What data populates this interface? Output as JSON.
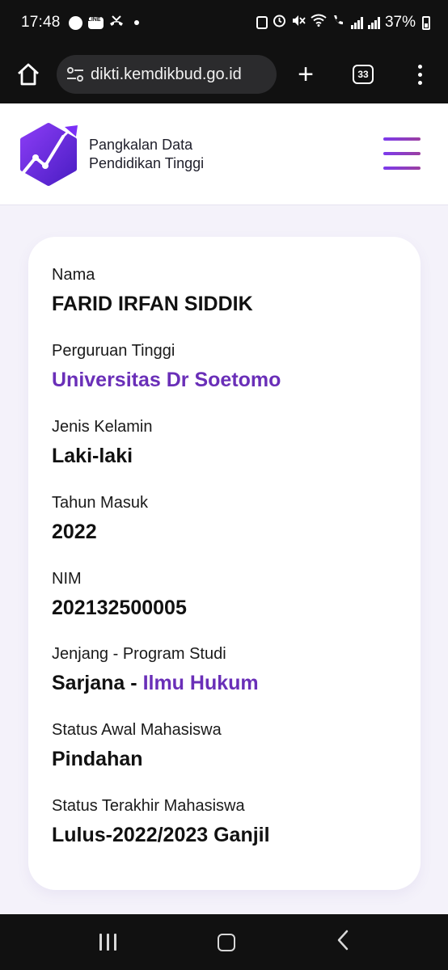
{
  "status_bar": {
    "time": "17:48",
    "line_badge": "LINE",
    "battery_percent": "37%"
  },
  "browser": {
    "url": "dikti.kemdikbud.go.id",
    "tab_count": "33",
    "new_tab_label": "+"
  },
  "site": {
    "brand_line1": "Pangkalan Data",
    "brand_line2": "Pendidikan Tinggi"
  },
  "student": {
    "fields": [
      {
        "label": "Nama",
        "value": "FARID IRFAN SIDDIK"
      },
      {
        "label": "Perguruan Tinggi",
        "value": "Universitas Dr Soetomo"
      },
      {
        "label": "Jenis Kelamin",
        "value": "Laki-laki"
      },
      {
        "label": "Tahun Masuk",
        "value": "2022"
      },
      {
        "label": "NIM",
        "value": "202132500005"
      },
      {
        "label": "Jenjang - Program Studi",
        "value_prefix": "Sarjana - ",
        "value_link": "Ilmu Hukum"
      },
      {
        "label": "Status Awal Mahasiswa",
        "value": "Pindahan"
      },
      {
        "label": "Status Terakhir Mahasiswa",
        "value": "Lulus-2022/2023 Ganjil"
      }
    ]
  },
  "colors": {
    "accent": "#6a2fb8",
    "logo_primary": "#7b2ff7",
    "logo_secondary": "#5a1fd1"
  }
}
